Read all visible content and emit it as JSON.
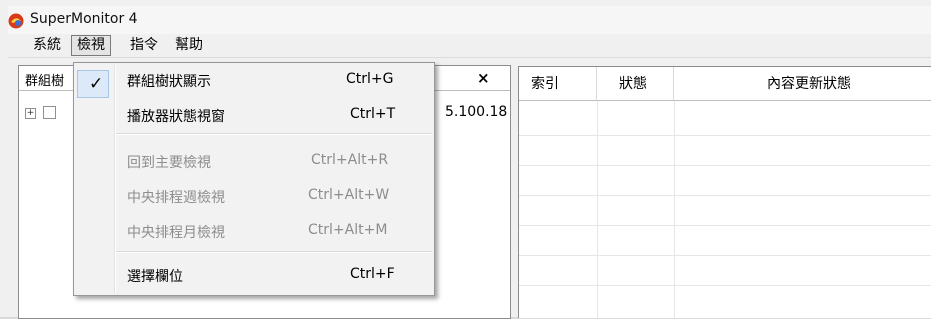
{
  "window": {
    "title": "SuperMonitor 4",
    "app_icon": "app-logo-icon"
  },
  "menubar": {
    "items": [
      {
        "label": "系統"
      },
      {
        "label": "檢視",
        "active": true
      },
      {
        "label": "指令"
      },
      {
        "label": "幫助"
      }
    ]
  },
  "left_pane": {
    "header_label": "群組樹",
    "close_label": "×",
    "tree_node_ip_fragment": "5.100.18"
  },
  "right_pane": {
    "columns": [
      "索引",
      "狀態",
      "內容更新狀態"
    ]
  },
  "view_menu": {
    "items": [
      {
        "label": "群組樹狀顯示",
        "shortcut": "Ctrl+G",
        "checked": true,
        "enabled": true
      },
      {
        "label": "播放器狀態視窗",
        "shortcut": "Ctrl+T",
        "checked": false,
        "enabled": true
      },
      {
        "label": "回到主要檢視",
        "shortcut": "Ctrl+Alt+R",
        "checked": false,
        "enabled": false
      },
      {
        "label": "中央排程週檢視",
        "shortcut": "Ctrl+Alt+W",
        "checked": false,
        "enabled": false
      },
      {
        "label": "中央排程月檢視",
        "shortcut": "Ctrl+Alt+M",
        "checked": false,
        "enabled": false
      },
      {
        "label": "選擇欄位",
        "shortcut": "Ctrl+F",
        "checked": false,
        "enabled": true
      }
    ],
    "check_glyph": "✓"
  }
}
